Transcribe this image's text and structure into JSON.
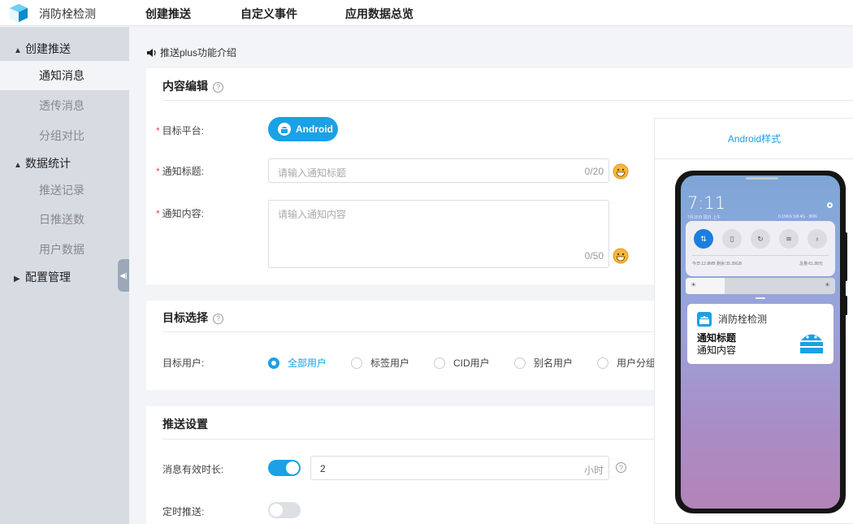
{
  "app": {
    "name": "消防栓检测"
  },
  "topnav": [
    "创建推送",
    "自定义事件",
    "应用数据总览"
  ],
  "sidebar": {
    "groups": [
      {
        "label": "创建推送",
        "expanded": true
      },
      {
        "label": "数据统计",
        "expanded": true
      },
      {
        "label": "配置管理",
        "expanded": false
      }
    ],
    "items": {
      "notify": "通知消息",
      "passthrough": "透传消息",
      "ab": "分组对比",
      "record": "推送记录",
      "daily": "日推送数",
      "users": "用户数据"
    },
    "active": "通知消息"
  },
  "intro": "推送plus功能介绍",
  "content": {
    "title": "内容编辑",
    "platform_label": "目标平台:",
    "platform_value": "Android",
    "title_label": "通知标题:",
    "title_placeholder": "请输入通知标题",
    "title_count": "0/20",
    "body_label": "通知内容:",
    "body_placeholder": "请输入通知内容",
    "body_count": "0/50"
  },
  "target": {
    "title": "目标选择",
    "label": "目标用户:",
    "options": [
      "全部用户",
      "标签用户",
      "CID用户",
      "别名用户",
      "用户分组"
    ],
    "selected": "全部用户"
  },
  "settings": {
    "title": "推送设置",
    "ttl_label": "消息有效时长:",
    "ttl_enabled": true,
    "ttl_value": "2",
    "ttl_unit": "小时",
    "schedule_label": "定时推送:",
    "schedule_enabled": false
  },
  "preview": {
    "title": "Android样式",
    "clock": "7:11",
    "date": "7月15日 周日 上午",
    "net": "0.15K/s 5dl 4G · 96%",
    "stats": "今日:12.8MB  剩余:35.39GB",
    "stats_right": "总量:61.88元",
    "app_name": "消防栓检测",
    "notif_title": "通知标题",
    "notif_body": "通知内容"
  },
  "colors": {
    "primary": "#1aa1e6",
    "sidebar": "#d7dce3",
    "required": "#e5484d"
  }
}
